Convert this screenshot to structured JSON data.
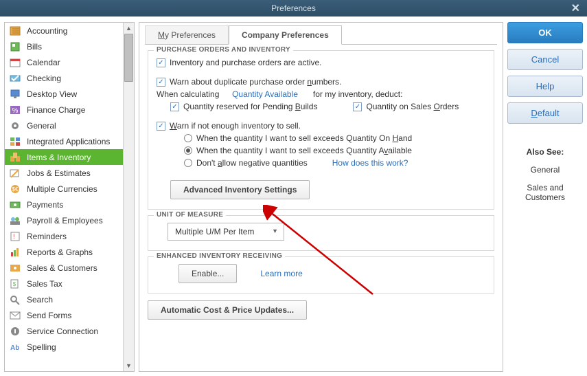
{
  "window": {
    "title": "Preferences"
  },
  "sidebar": {
    "items": [
      {
        "label": "Accounting"
      },
      {
        "label": "Bills"
      },
      {
        "label": "Calendar"
      },
      {
        "label": "Checking"
      },
      {
        "label": "Desktop View"
      },
      {
        "label": "Finance Charge"
      },
      {
        "label": "General"
      },
      {
        "label": "Integrated Applications"
      },
      {
        "label": "Items & Inventory"
      },
      {
        "label": "Jobs & Estimates"
      },
      {
        "label": "Multiple Currencies"
      },
      {
        "label": "Payments"
      },
      {
        "label": "Payroll & Employees"
      },
      {
        "label": "Reminders"
      },
      {
        "label": "Reports & Graphs"
      },
      {
        "label": "Sales & Customers"
      },
      {
        "label": "Sales Tax"
      },
      {
        "label": "Search"
      },
      {
        "label": "Send Forms"
      },
      {
        "label": "Service Connection"
      },
      {
        "label": "Spelling"
      }
    ]
  },
  "tabs": {
    "my": "My Preferences",
    "company": "Company Preferences"
  },
  "po_group": {
    "title": "PURCHASE ORDERS AND INVENTORY",
    "inventory_active": "Inventory and purchase orders are active.",
    "warn_dup_pre": "Warn about duplicate purchase order ",
    "warn_dup_ul": "n",
    "warn_dup_post": "umbers.",
    "when_calc": "When calculating",
    "qty_available": "Quantity Available",
    "for_deduct": "for my inventory, deduct:",
    "qty_pending_pre": "Quantity reserved for Pending ",
    "qty_pending_ul": "B",
    "qty_pending_post": "uilds",
    "qty_sales_pre": "Quantity on Sales ",
    "qty_sales_ul": "O",
    "qty_sales_post": "rders",
    "warn_not_enough_pre": "",
    "warn_not_enough_ul": "W",
    "warn_not_enough_post": "arn if not enough inventory to sell.",
    "rad1_pre": "When the quantity I want to sell exceeds Quantity On ",
    "rad1_ul": "H",
    "rad1_post": "and",
    "rad2_pre": "When the quantity I want to sell exceeds Quantity A",
    "rad2_ul": "v",
    "rad2_post": "ailable",
    "rad3_pre": "Don't ",
    "rad3_ul": "a",
    "rad3_post": "llow negative quantities",
    "how_link": "How does this work?",
    "adv_btn": "Advanced Inventory Settings"
  },
  "uom_group": {
    "title": "UNIT OF MEASURE",
    "select_value": "Multiple U/M Per Item"
  },
  "eir_group": {
    "title": "ENHANCED INVENTORY RECEIVING",
    "enable_btn": "Enable...",
    "learn_more": "Learn more"
  },
  "auto_btn": "Automatic Cost & Price Updates...",
  "buttons": {
    "ok": "OK",
    "cancel": "Cancel",
    "help": "Help",
    "default_pre": "",
    "default_ul": "D",
    "default_post": "efault"
  },
  "alsosee": {
    "hdr": "Also See:",
    "l1": "General",
    "l2": "Sales and Customers"
  }
}
